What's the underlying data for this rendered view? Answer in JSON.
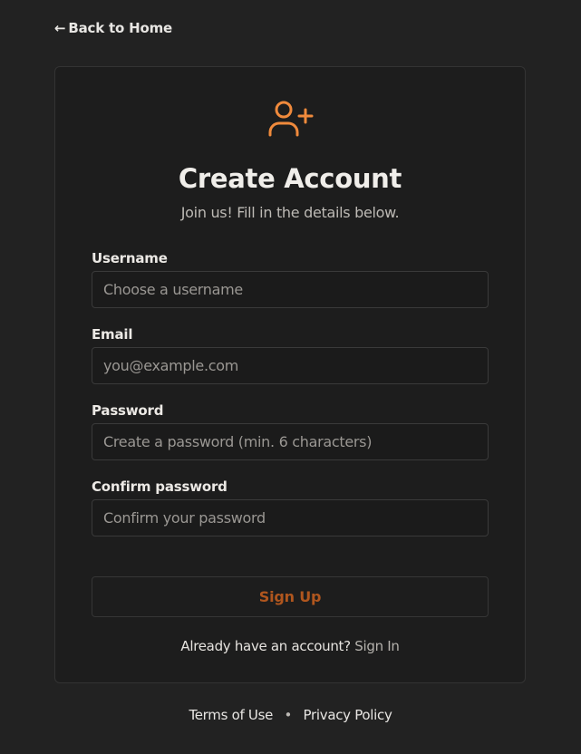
{
  "nav": {
    "back_arrow": "←",
    "back_label": "Back to Home"
  },
  "header": {
    "icon": "user-plus-icon",
    "title": "Create Account",
    "subtitle": "Join us! Fill in the details below."
  },
  "form": {
    "username": {
      "label": "Username",
      "value": "",
      "placeholder": "Choose a username"
    },
    "email": {
      "label": "Email",
      "value": "",
      "placeholder": "you@example.com"
    },
    "password": {
      "label": "Password",
      "value": "",
      "placeholder": "Create a password (min. 6 characters)"
    },
    "confirm_password": {
      "label": "Confirm password",
      "value": "",
      "placeholder": "Confirm your password"
    },
    "submit_label": "Sign Up"
  },
  "signin": {
    "prompt": "Already have an account?",
    "link_label": "Sign In"
  },
  "footer": {
    "terms_label": "Terms of Use",
    "separator": "•",
    "privacy_label": "Privacy Policy"
  },
  "colors": {
    "background": "#222222",
    "card": "#1d1d1d",
    "accent": "#f08a3c",
    "button_text": "#b0561e"
  }
}
